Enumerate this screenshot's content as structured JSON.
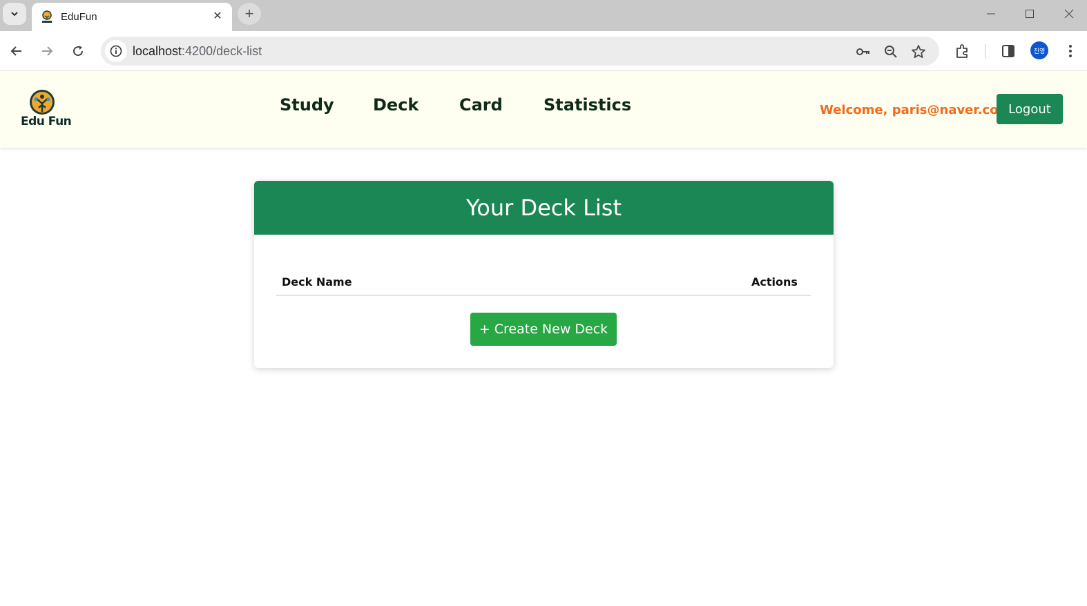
{
  "browser": {
    "tab_title": "EduFun",
    "url_host": "localhost",
    "url_path": ":4200/deck-list",
    "avatar_text": "진영",
    "icons": [
      "tab-search-icon",
      "edufun-favicon-icon",
      "close-icon",
      "plus-icon",
      "minimize-icon",
      "maximize-icon",
      "window-close-icon",
      "back-arrow-icon",
      "forward-arrow-icon",
      "reload-icon",
      "site-info-icon",
      "key-icon",
      "zoom-icon",
      "star-icon",
      "extensions-icon",
      "side-panel-icon",
      "more-vert-icon"
    ]
  },
  "header": {
    "logo_text": "Edu Fun",
    "nav": [
      "Study",
      "Deck",
      "Card",
      "Statistics"
    ],
    "welcome": "Welcome, paris@naver.com!",
    "logout_label": "Logout"
  },
  "deck_list": {
    "title": "Your Deck List",
    "columns": [
      "Deck Name",
      "Actions"
    ],
    "rows": [],
    "create_button_label": "+ Create New Deck"
  },
  "colors": {
    "primary_green": "#1a8754",
    "button_green": "#28a745",
    "welcome_orange": "#f26a1b",
    "header_bg": "#fefff0"
  }
}
